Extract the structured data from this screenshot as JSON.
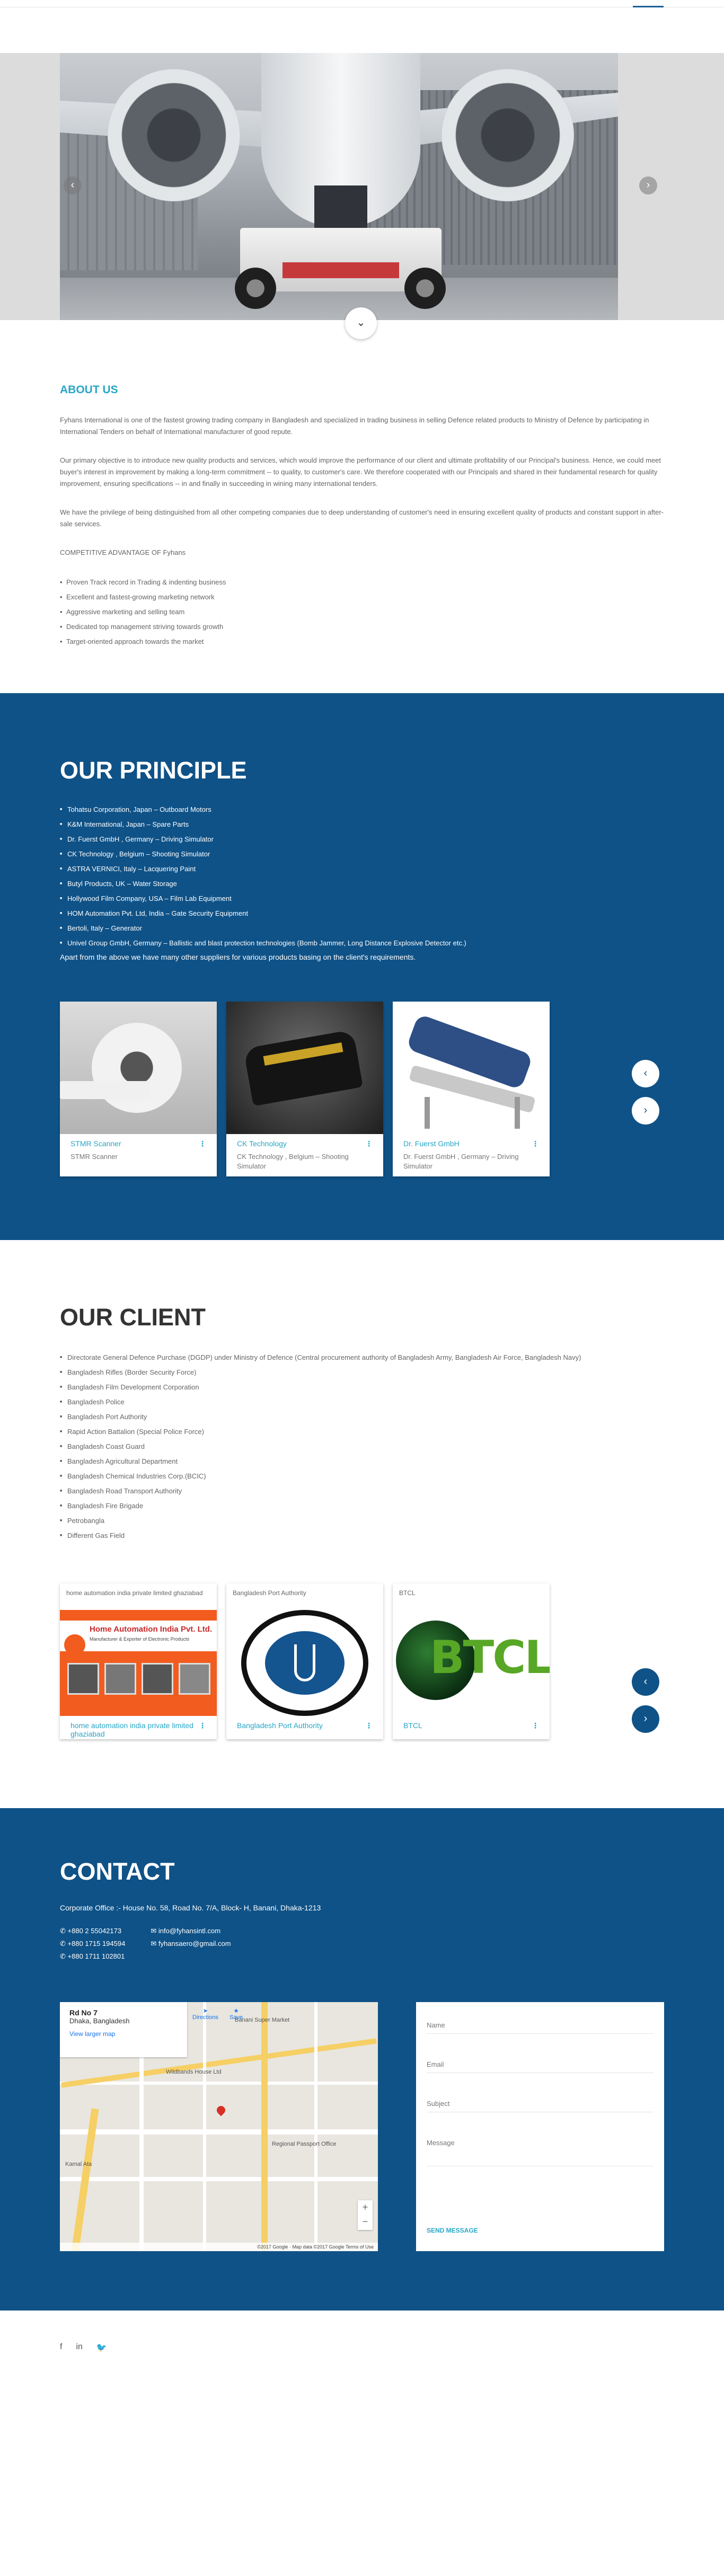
{
  "about": {
    "title": "ABOUT US",
    "paragraphs": [
      "Fyhans International is one of the fastest growing trading company in Bangladesh and specialized in trading business in selling Defence related products to Ministry of Defence by participating in International Tenders on behalf of International manufacturer of good repute.",
      "Our primary objective is to introduce new quality products and services, which would improve the performance of our client and ultimate profitability of our Principal's business. Hence, we could meet buyer's interest in improvement by making a long-term commitment -- to quality, to customer's care. We therefore cooperated with our Principals and shared in their fundamental research for quality improvement, ensuring specifications -- in and finally in succeeding in wining many international tenders.",
      "We have the privilege of being distinguished from all other competing companies due to deep understanding of customer's need in ensuring excellent quality of products and constant support in after-sale services.",
      "COMPETITIVE ADVANTAGE OF Fyhans"
    ],
    "advantages": [
      "Proven Track record in Trading & indenting business",
      "Excellent and fastest-growing marketing network",
      "Aggressive marketing and selling team",
      "Dedicated top management striving towards growth",
      "Target-oriented approach towards the market"
    ]
  },
  "principle": {
    "title": "OUR PRINCIPLE",
    "items": [
      "Tohatsu Corporation, Japan – Outboard Motors",
      "K&M International, Japan – Spare Parts",
      "Dr. Fuerst GmbH , Germany – Driving Simulator",
      "CK Technology , Belgium – Shooting Simulator",
      "ASTRA VERNICI, Italy – Lacquering Paint",
      "Butyl Products, UK – Water Storage",
      "Hollywood Film Company, USA – Film Lab Equipment",
      "HOM Automation Pvt. Ltd, India – Gate Security Equipment",
      "Bertoli, Italy – Generator",
      "Univel Group GmbH, Germany – Ballistic and blast protection technologies (Bomb Jammer, Long Distance Explosive Detector etc.)"
    ],
    "note": "Apart from the above we have many other suppliers for various products basing on the client's requirements.",
    "cards": [
      {
        "title": "STMR Scanner",
        "subtitle": "STMR Scanner"
      },
      {
        "title": "CK Technology",
        "subtitle": "CK Technology , Belgium – Shooting Simulator"
      },
      {
        "title": "Dr. Fuerst GmbH",
        "subtitle": "Dr. Fuerst GmbH , Germany – Driving Simulator"
      }
    ]
  },
  "client": {
    "title": "OUR CLIENT",
    "items": [
      "Directorate General Defence Purchase (DGDP) under Ministry of Defence (Central procurement authority of Bangladesh Army, Bangladesh Air Force, Bangladesh Navy)",
      "Bangladesh Rifles (Border Security Force)",
      "Bangladesh Film Development Corporation",
      "Bangladesh Police",
      "Bangladesh Port Authority",
      "Rapid Action Battalion (Special Police Force)",
      "Bangladesh Coast Guard",
      "Bangladesh Agricultural Department",
      "Bangladesh Chemical Industries Corp.(BCIC)",
      "Bangladesh Road Transport Authority",
      "Bangladesh Fire Brigade",
      "Petrobangla",
      "Different Gas Field"
    ],
    "cards": [
      {
        "top": "home automation india private limited ghaziabad",
        "title": "home automation india private limited ghaziabad",
        "logo_name": "Home Automation India Pvt. Ltd.",
        "logo_tag": "Manufacturer & Exporter of Electronic Products"
      },
      {
        "top": "Bangladesh Port Authority",
        "title": "Bangladesh Port Authority"
      },
      {
        "top": "BTCL",
        "title": "BTCL",
        "logo_word": "BTCL"
      }
    ]
  },
  "contact": {
    "title": "CONTACT",
    "address": "Corporate Office :- House No. 58, Road No. 7/A, Block- H, Banani, Dhaka-1213",
    "phones": [
      "+880 2 55042173",
      "+880 1715 194594",
      "+880 1711 102801"
    ],
    "emails": [
      "info@fyhansintl.com",
      "fyhansaero@gmail.com"
    ],
    "map": {
      "place": "Rd No 7",
      "region": "Dhaka, Bangladesh",
      "larger_map": "View larger map",
      "directions": "Directions",
      "save": "Save",
      "labels": [
        "Banani Super Market",
        "Wildbands House Ltd",
        "Regional Passport Office",
        "Kamal Ata"
      ],
      "footer": "©2017 Google · Map data ©2017 Google   Terms of Use"
    },
    "form": {
      "name_placeholder": "Name",
      "email_placeholder": "Email",
      "subject_placeholder": "Subject",
      "message_placeholder": "Message",
      "send_label": "SEND MESSAGE"
    }
  },
  "colors": {
    "accent": "#28a6c6",
    "brand_blue": "#0f5287"
  },
  "icons": [
    "chevron-left-icon",
    "chevron-right-icon",
    "chevron-down-icon",
    "phone-icon",
    "mail-icon",
    "facebook-icon",
    "linkedin-icon",
    "twitter-icon"
  ]
}
